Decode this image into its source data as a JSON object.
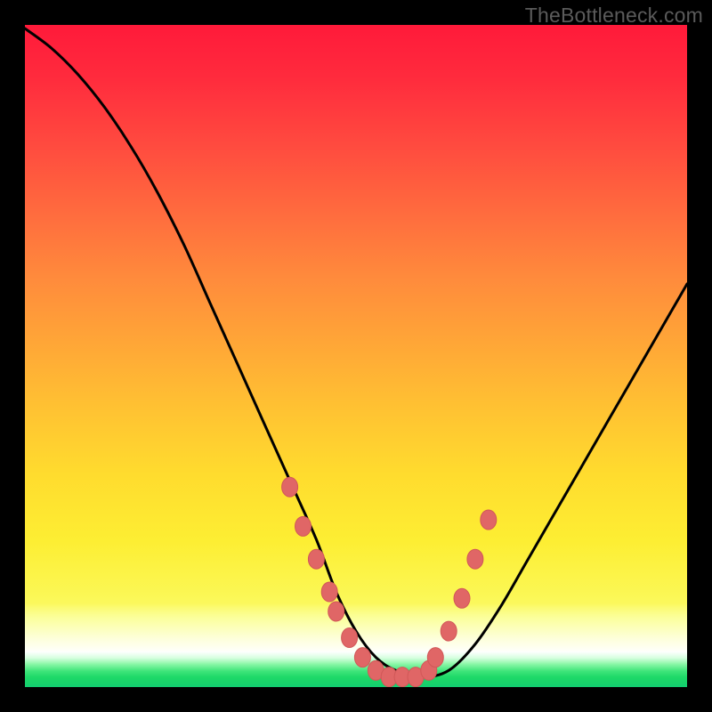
{
  "watermark": "TheBottleneck.com",
  "colors": {
    "curve_stroke": "#000000",
    "marker_fill": "#e06666",
    "marker_stroke": "#d15858"
  },
  "chart_data": {
    "type": "line",
    "title": "",
    "xlabel": "",
    "ylabel": "",
    "xlim": [
      0,
      100
    ],
    "ylim": [
      0,
      100
    ],
    "series": [
      {
        "name": "bottleneck-curve",
        "x": [
          0,
          4,
          8,
          12,
          16,
          20,
          24,
          28,
          32,
          36,
          40,
          44,
          47,
          50,
          53,
          56,
          60,
          64,
          68,
          72,
          76,
          80,
          84,
          88,
          92,
          96,
          100
        ],
        "y": [
          100,
          97,
          93,
          88,
          82,
          75,
          67,
          58,
          49,
          40,
          31,
          22,
          14,
          8,
          4,
          2,
          1,
          2,
          6,
          12,
          19,
          26,
          33,
          40,
          47,
          54,
          61
        ]
      }
    ],
    "markers": {
      "name": "highlighted-points",
      "x": [
        40,
        42,
        44,
        46,
        47,
        49,
        51,
        53,
        55,
        57,
        59,
        61,
        62,
        64,
        66,
        68,
        70
      ],
      "y": [
        30,
        24,
        19,
        14,
        11,
        7,
        4,
        2,
        1,
        1,
        1,
        2,
        4,
        8,
        13,
        19,
        25
      ]
    }
  }
}
